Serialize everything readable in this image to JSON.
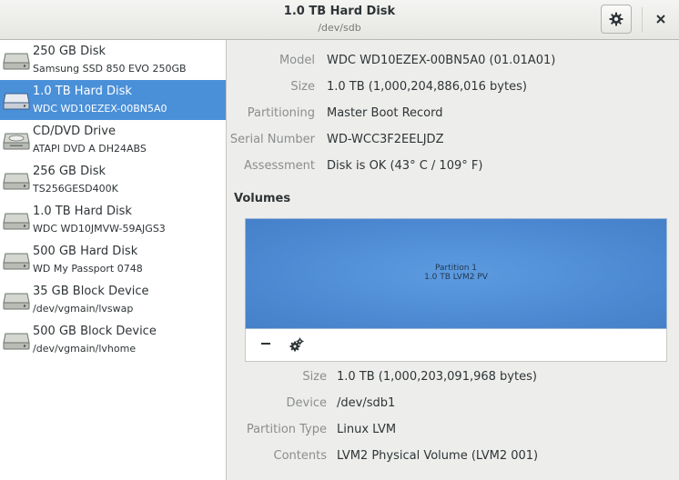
{
  "header": {
    "title": "1.0 TB Hard Disk",
    "subtitle": "/dev/sdb",
    "gear_icon": "gear-icon",
    "close_icon": "close-icon"
  },
  "sidebar": {
    "items": [
      {
        "name": "250 GB Disk",
        "desc": "Samsung SSD 850 EVO 250GB",
        "icon": "harddisk-icon",
        "selected": false
      },
      {
        "name": "1.0 TB Hard Disk",
        "desc": "WDC WD10EZEX-00BN5A0",
        "icon": "harddisk-icon",
        "selected": true
      },
      {
        "name": "CD/DVD Drive",
        "desc": "ATAPI   DVD A  DH24ABS",
        "icon": "optical-drive-icon",
        "selected": false
      },
      {
        "name": "256 GB Disk",
        "desc": "TS256GESD400K",
        "icon": "harddisk-icon",
        "selected": false
      },
      {
        "name": "1.0 TB Hard Disk",
        "desc": "WDC WD10JMVW-59AJGS3",
        "icon": "harddisk-icon",
        "selected": false
      },
      {
        "name": "500 GB Hard Disk",
        "desc": "WD My Passport 0748",
        "icon": "harddisk-icon",
        "selected": false
      },
      {
        "name": "35 GB Block Device",
        "desc": "/dev/vgmain/lvswap",
        "icon": "harddisk-icon",
        "selected": false
      },
      {
        "name": "500 GB Block Device",
        "desc": "/dev/vgmain/lvhome",
        "icon": "harddisk-icon",
        "selected": false
      }
    ]
  },
  "disk": {
    "model_label": "Model",
    "model": "WDC WD10EZEX-00BN5A0 (01.01A01)",
    "size_label": "Size",
    "size": "1.0 TB (1,000,204,886,016 bytes)",
    "partitioning_label": "Partitioning",
    "partitioning": "Master Boot Record",
    "serial_label": "Serial Number",
    "serial": "WD-WCC3F2EELJDZ",
    "assessment_label": "Assessment",
    "assessment": "Disk is OK (43° C / 109° F)"
  },
  "volumes": {
    "title": "Volumes",
    "partition_name": "Partition 1",
    "partition_detail": "1.0 TB LVM2 PV",
    "remove_label": "−",
    "settings_icon": "gear-icon",
    "color": "#4a90d9"
  },
  "partition": {
    "size_label": "Size",
    "size": "1.0 TB (1,000,203,091,968 bytes)",
    "device_label": "Device",
    "device": "/dev/sdb1",
    "type_label": "Partition Type",
    "type": "Linux LVM",
    "contents_label": "Contents",
    "contents": "LVM2 Physical Volume (LVM2 001)"
  }
}
